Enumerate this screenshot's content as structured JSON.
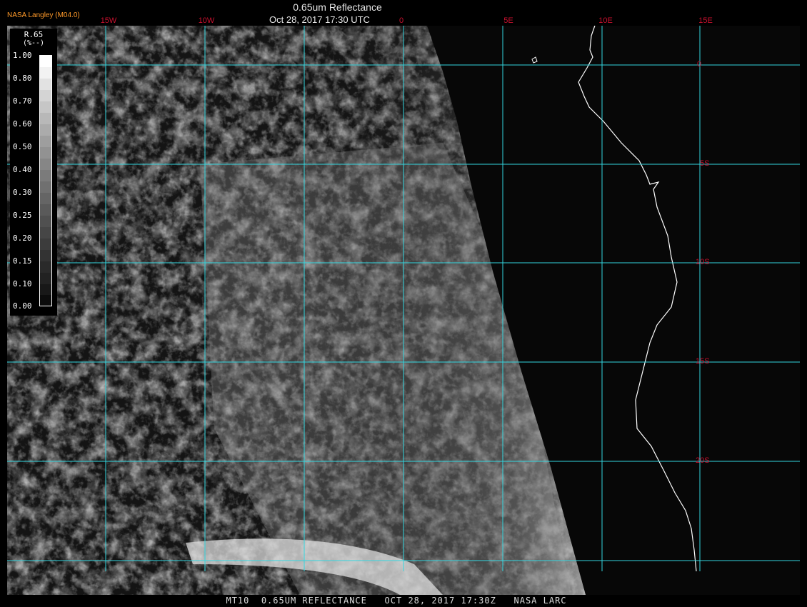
{
  "header": {
    "org_label": "NASA Langley (M04.0)",
    "title": "0.65um Reflectance",
    "datetime": "Oct 28, 2017 17:30 UTC"
  },
  "grid": {
    "lon_labels": [
      "15W",
      "10W",
      "0",
      "5E",
      "10E",
      "15E"
    ],
    "lat_labels": [
      "0",
      "5S",
      "10S",
      "15S",
      "20S"
    ]
  },
  "legend": {
    "title": "R.65",
    "units": "(%--)",
    "ticks": [
      "1.00",
      "0.80",
      "0.70",
      "0.60",
      "0.50",
      "0.40",
      "0.30",
      "0.25",
      "0.20",
      "0.15",
      "0.10",
      "0.00"
    ]
  },
  "status": {
    "text": "MT10  0.65UM REFLECTANCE   OCT 28, 2017 17:30Z   NASA LARC"
  },
  "colors": {
    "grid": "#33d6df",
    "label_red": "#c8102e",
    "org_label": "#ff9a2a",
    "coast": "#ffffff"
  }
}
